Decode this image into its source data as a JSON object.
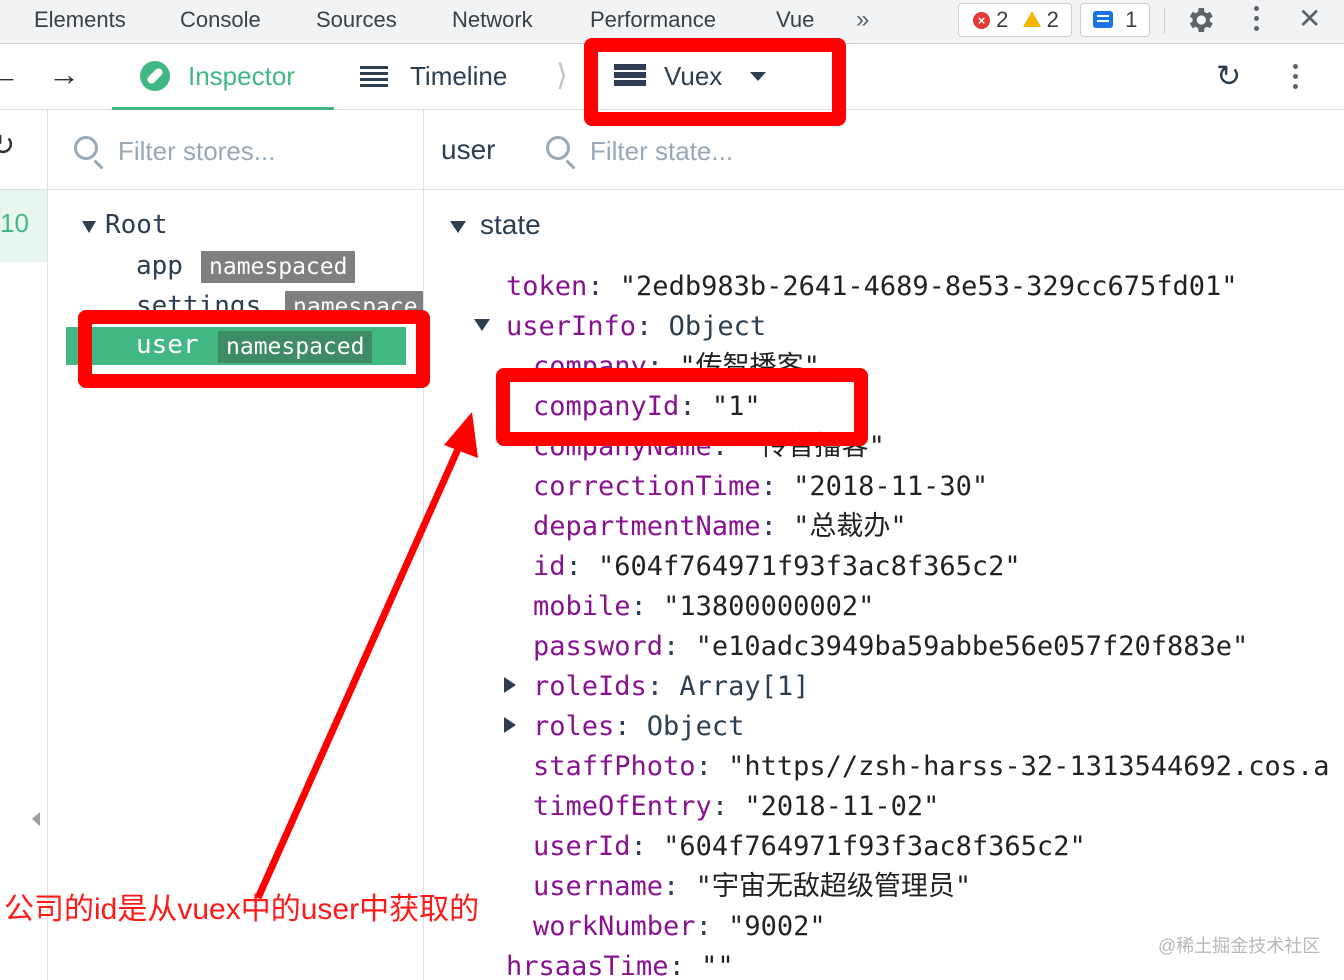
{
  "devtools_tabs": [
    "Elements",
    "Console",
    "Sources",
    "Network",
    "Performance",
    "Vue"
  ],
  "devtools_more": "»",
  "errors_count": "2",
  "warnings_count": "2",
  "messages_count": "1",
  "close_label": "✕",
  "vue_toolbar": {
    "back_arrow": "←",
    "forward_arrow": "→",
    "inspector_label": "Inspector",
    "timeline_label": "Timeline",
    "chevron": "⟩",
    "vuex_label": "Vuex",
    "refresh_glyph": "↻"
  },
  "stores_filter_placeholder": "Filter stores...",
  "state_module_label": "user",
  "state_filter_placeholder": "Filter state...",
  "gutter_number": "10",
  "store_tree": {
    "root_label": "Root",
    "modules": [
      {
        "name": "app",
        "tag": "namespaced"
      },
      {
        "name": "settings",
        "tag": "namespace"
      },
      {
        "name": "user",
        "tag": "namespaced"
      }
    ]
  },
  "state": {
    "section_label": "state",
    "token_key": "token",
    "token_value": "\"2edb983b-2641-4689-8e53-329cc675fd01\"",
    "userinfo_key": "userInfo",
    "userinfo_type": "Object",
    "fields": [
      {
        "key": "company",
        "value": "\"传智播客\""
      },
      {
        "key": "companyId",
        "value": "\"1\""
      },
      {
        "key": "companyName",
        "value": "\"传智播客\""
      },
      {
        "key": "correctionTime",
        "value": "\"2018-11-30\""
      },
      {
        "key": "departmentName",
        "value": "\"总裁办\""
      },
      {
        "key": "id",
        "value": "\"604f764971f93f3ac8f365c2\""
      },
      {
        "key": "mobile",
        "value": "\"13800000002\""
      },
      {
        "key": "password",
        "value": "\"e10adc3949ba59abbe56e057f20f883e\""
      },
      {
        "key": "roleIds",
        "value": "Array[1]"
      },
      {
        "key": "roles",
        "value": "Object"
      },
      {
        "key": "staffPhoto",
        "value": "\"https//zsh-harss-32-1313544692.cos.a"
      },
      {
        "key": "timeOfEntry",
        "value": "\"2018-11-02\""
      },
      {
        "key": "userId",
        "value": "\"604f764971f93f3ac8f365c2\""
      },
      {
        "key": "username",
        "value": "\"宇宙无敌超级管理员\""
      },
      {
        "key": "workNumber",
        "value": "\"9002\""
      }
    ],
    "hrsaas_key": "hrsaasTime",
    "hrsaas_value": "\"\""
  },
  "annotation_text": "公司的id是从vuex中的user中获取的",
  "watermark": "@稀土掘金技术社区",
  "colors": {
    "vue_green": "#41b883",
    "annotation_red": "#ff0000",
    "key_purple": "#881391"
  }
}
